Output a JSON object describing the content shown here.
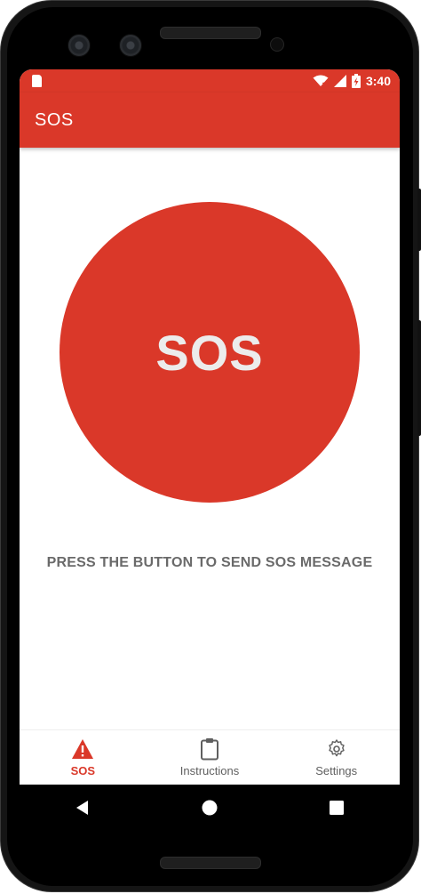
{
  "status_bar": {
    "time": "3:40",
    "icons": [
      "sd-card-icon",
      "wifi-icon",
      "signal-icon",
      "battery-charging-icon"
    ]
  },
  "app_bar": {
    "title": "SOS"
  },
  "main": {
    "sos_button_label": "SOS",
    "instruction": "PRESS THE BUTTON TO SEND SOS MESSAGE"
  },
  "bottom_nav": {
    "items": [
      {
        "label": "SOS",
        "icon": "warning-icon",
        "active": true
      },
      {
        "label": "Instructions",
        "icon": "clipboard-icon",
        "active": false
      },
      {
        "label": "Settings",
        "icon": "gear-icon",
        "active": false
      }
    ]
  },
  "system_nav": {
    "buttons": [
      "back-icon",
      "home-icon",
      "recents-icon"
    ]
  },
  "colors": {
    "primary": "#da3829",
    "on_primary": "#ffffff",
    "text_secondary": "#6a6a6a"
  }
}
